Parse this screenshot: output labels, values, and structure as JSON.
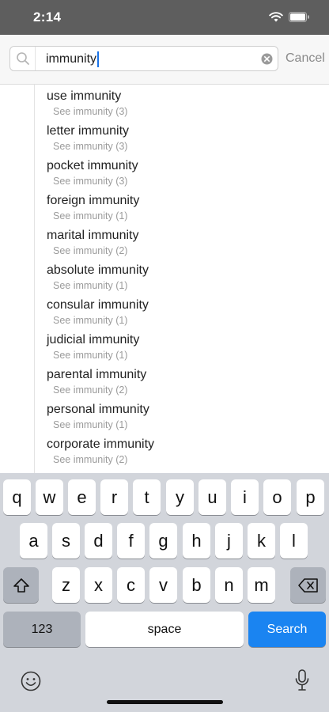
{
  "status_bar": {
    "time": "2:14"
  },
  "search": {
    "value": "immunity",
    "cancel_label": "Cancel"
  },
  "results": [
    {
      "term": "use immunity",
      "sub": "See immunity (3)"
    },
    {
      "term": "letter immunity",
      "sub": "See immunity (3)"
    },
    {
      "term": "pocket immunity",
      "sub": "See immunity (3)"
    },
    {
      "term": "foreign immunity",
      "sub": "See immunity (1)"
    },
    {
      "term": "marital immunity",
      "sub": "See immunity (2)"
    },
    {
      "term": "absolute immunity",
      "sub": "See immunity (1)"
    },
    {
      "term": "consular immunity",
      "sub": "See immunity (1)"
    },
    {
      "term": "judicial immunity",
      "sub": "See immunity (1)"
    },
    {
      "term": "parental immunity",
      "sub": "See immunity (2)"
    },
    {
      "term": "personal immunity",
      "sub": "See immunity (1)"
    },
    {
      "term": "corporate immunity",
      "sub": "See immunity (2)"
    }
  ],
  "keyboard": {
    "row1": [
      "q",
      "w",
      "e",
      "r",
      "t",
      "y",
      "u",
      "i",
      "o",
      "p"
    ],
    "row2": [
      "a",
      "s",
      "d",
      "f",
      "g",
      "h",
      "j",
      "k",
      "l"
    ],
    "row3": [
      "z",
      "x",
      "c",
      "v",
      "b",
      "n",
      "m"
    ],
    "numbers_label": "123",
    "space_label": "space",
    "search_label": "Search",
    "shift_icon": "shift-icon",
    "delete_icon": "delete-icon",
    "emoji_icon": "emoji-icon",
    "mic_icon": "microphone-icon"
  },
  "colors": {
    "accent": "#1a84f1",
    "status_bar": "#5e5e5e",
    "keyboard_bg": "#d2d5db"
  }
}
